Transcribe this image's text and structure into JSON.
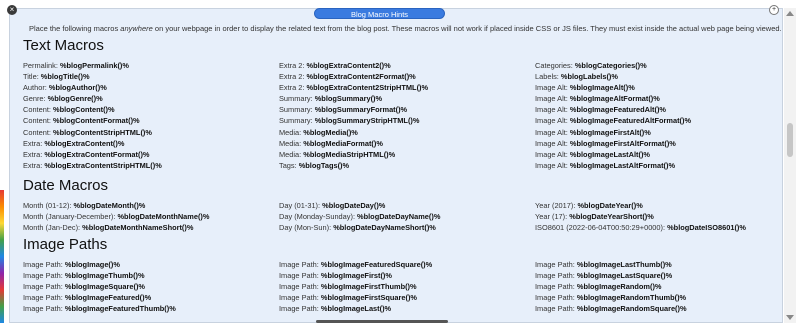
{
  "window": {
    "title": "Blog Macro Hints",
    "close_glyph": "×",
    "maximize_glyph": "+"
  },
  "intro": {
    "before": "Place the following macros ",
    "emph": "anywhere",
    "after": " on your webpage in order to display the related text from the blog post. These macros will not work if placed inside CSS or JS files. They must exist inside the actual web page being viewed."
  },
  "sections": {
    "text_macros": {
      "heading": "Text Macros",
      "rows": [
        [
          [
            "Permalink: ",
            "%blogPermalink()%"
          ],
          [
            "Extra 2: ",
            "%blogExtraContent2()%"
          ],
          [
            "Categories: ",
            "%blogCategories()%"
          ]
        ],
        [
          [
            "Title: ",
            "%blogTitle()%"
          ],
          [
            "Extra 2: ",
            "%blogExtraContent2Format()%"
          ],
          [
            "Labels: ",
            "%blogLabels()%"
          ]
        ],
        [
          [
            "Author: ",
            "%blogAuthor()%"
          ],
          [
            "Extra 2: ",
            "%blogExtraContent2StripHTML()%"
          ],
          [
            "Image Alt: ",
            "%blogImageAlt()%"
          ]
        ],
        [
          [
            "Genre: ",
            "%blogGenre()%"
          ],
          [
            "Summary: ",
            "%blogSummary()%"
          ],
          [
            "Image Alt: ",
            "%blogImageAltFormat()%"
          ]
        ],
        [
          [
            "Content: ",
            "%blogContent()%"
          ],
          [
            "Summary: ",
            "%blogSummaryFormat()%"
          ],
          [
            "Image Alt: ",
            "%blogImageFeaturedAlt()%"
          ]
        ],
        [
          [
            "Content: ",
            "%blogContentFormat()%"
          ],
          [
            "Summary: ",
            "%blogSummaryStripHTML()%"
          ],
          [
            "Image Alt: ",
            "%blogImageFeaturedAltFormat()%"
          ]
        ],
        [
          [
            "Content: ",
            "%blogContentStripHTML()%"
          ],
          [
            "Media: ",
            "%blogMedia()%"
          ],
          [
            "Image Alt: ",
            "%blogImageFirstAlt()%"
          ]
        ],
        [
          [
            "Extra: ",
            "%blogExtraContent()%"
          ],
          [
            "Media: ",
            "%blogMediaFormat()%"
          ],
          [
            "Image Alt: ",
            "%blogImageFirstAltFormat()%"
          ]
        ],
        [
          [
            "Extra: ",
            "%blogExtraContentFormat()%"
          ],
          [
            "Media: ",
            "%blogMediaStripHTML()%"
          ],
          [
            "Image Alt: ",
            "%blogImageLastAlt()%"
          ]
        ],
        [
          [
            "Extra: ",
            "%blogExtraContentStripHTML()%"
          ],
          [
            "Tags: ",
            "%blogTags()%"
          ],
          [
            "Image Alt: ",
            "%blogImageLastAltFormat()%"
          ]
        ]
      ]
    },
    "date_macros": {
      "heading": "Date Macros",
      "rows": [
        [
          [
            "Month (01-12): ",
            "%blogDateMonth()%"
          ],
          [
            "Day (01-31): ",
            "%blogDateDay()%"
          ],
          [
            "Year (2017): ",
            "%blogDateYear()%"
          ]
        ],
        [
          [
            "Month (January-December): ",
            "%blogDateMonthName()%"
          ],
          [
            "Day (Monday-Sunday): ",
            "%blogDateDayName()%"
          ],
          [
            "Year (17): ",
            "%blogDateYearShort()%"
          ]
        ],
        [
          [
            "Month (Jan-Dec): ",
            "%blogDateMonthNameShort()%"
          ],
          [
            "Day (Mon-Sun): ",
            "%blogDateDayNameShort()%"
          ],
          [
            "ISO8601 (2022-06-04T00:50:29+0000): ",
            "%blogDateISO8601()%"
          ]
        ]
      ]
    },
    "image_paths": {
      "heading": "Image Paths",
      "rows": [
        [
          [
            "Image Path: ",
            "%blogImage()%"
          ],
          [
            "Image Path: ",
            "%blogImageFeaturedSquare()%"
          ],
          [
            "Image Path: ",
            "%blogImageLastThumb()%"
          ]
        ],
        [
          [
            "Image Path: ",
            "%blogImageThumb()%"
          ],
          [
            "Image Path: ",
            "%blogImageFirst()%"
          ],
          [
            "Image Path: ",
            "%blogImageLastSquare()%"
          ]
        ],
        [
          [
            "Image Path: ",
            "%blogImageSquare()%"
          ],
          [
            "Image Path: ",
            "%blogImageFirstThumb()%"
          ],
          [
            "Image Path: ",
            "%blogImageRandom()%"
          ]
        ],
        [
          [
            "Image Path: ",
            "%blogImageFeatured()%"
          ],
          [
            "Image Path: ",
            "%blogImageFirstSquare()%"
          ],
          [
            "Image Path: ",
            "%blogImageRandomThumb()%"
          ]
        ],
        [
          [
            "Image Path: ",
            "%blogImageFeaturedThumb()%"
          ],
          [
            "Image Path: ",
            "%blogImageLast()%"
          ],
          [
            "Image Path: ",
            "%blogImageRandomSquare()%"
          ]
        ]
      ]
    }
  },
  "icons": {
    "close": "close-icon",
    "maximize": "maximize-icon",
    "scroll_up": "scroll-up-icon",
    "scroll_down": "scroll-down-icon"
  },
  "colors": {
    "panel_bg": "#e7effa",
    "title_pill": "#3a7be0"
  }
}
